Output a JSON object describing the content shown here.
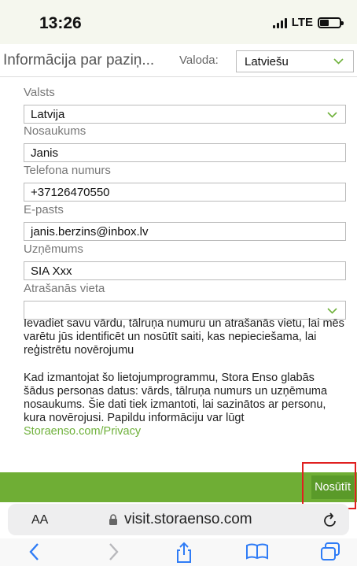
{
  "status": {
    "time": "13:26",
    "network": "LTE"
  },
  "header": {
    "title": "Informācija par paziņ...",
    "language_label": "Valoda:",
    "language_value": "Latviešu"
  },
  "form": {
    "country": {
      "label": "Valsts",
      "value": "Latvija"
    },
    "name": {
      "label": "Nosaukums",
      "value": "Janis"
    },
    "phone": {
      "label": "Telefona numurs",
      "value": "+37126470550"
    },
    "email": {
      "label": "E-pasts",
      "value": "janis.berzins@inbox.lv"
    },
    "company": {
      "label": "Uzņēmums",
      "value": "SIA Xxx"
    },
    "location": {
      "label": "Atrašanās vieta",
      "value": ""
    }
  },
  "help_text": "Ievadiet savu vārdu, tālruņa numuru un atrašanās vietu, lai mēs varētu jūs identificēt un nosūtīt saiti, kas nepieciešama, lai reģistrētu novērojumu",
  "privacy": {
    "text": "Kad izmantojat šo lietojumprogrammu, Stora Enso glabās šādus personas datus: vārds, tālruņa numurs un uzņēmuma nosaukums. Šie dati tiek izmantoti, lai sazinātos ar personu, kura novērojusi. Papildu informāciju var lūgt ",
    "link": "Storaenso.com/Privacy"
  },
  "footer": {
    "send_label": "Nosūtīt"
  },
  "browser": {
    "aa_label": "AA",
    "url": "visit.storaenso.com"
  },
  "colors": {
    "brand_green": "#6fae35",
    "link_green": "#6fb13b",
    "highlight_red": "#e02020"
  },
  "icons": [
    "signal-icon",
    "battery-icon",
    "chevron-down-icon",
    "lock-icon",
    "reload-icon",
    "back-icon",
    "forward-icon",
    "share-icon",
    "bookmarks-icon",
    "tabs-icon"
  ]
}
